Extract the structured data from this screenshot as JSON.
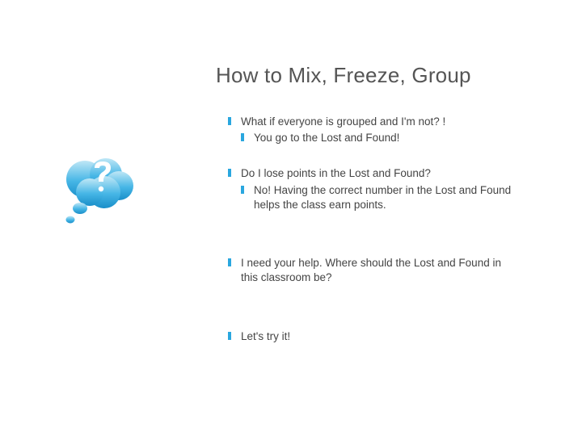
{
  "title": "How to Mix, Freeze, Group",
  "blocks": [
    {
      "text": "What if everyone is grouped and I'm not? !",
      "sub": "You go to the Lost and Found!",
      "tallGap": false
    },
    {
      "text": "Do I lose points in the Lost and Found?",
      "sub": "No! Having the correct number in the Lost and Found helps the class earn points.",
      "tallGap": true
    },
    {
      "text": "I need your help. Where should the Lost and Found in this classroom be?",
      "sub": null,
      "tallGap": true
    },
    {
      "text": "Let's try it!",
      "sub": null,
      "tallGap": false
    }
  ],
  "icon": {
    "name": "thought-bubble-icon"
  }
}
